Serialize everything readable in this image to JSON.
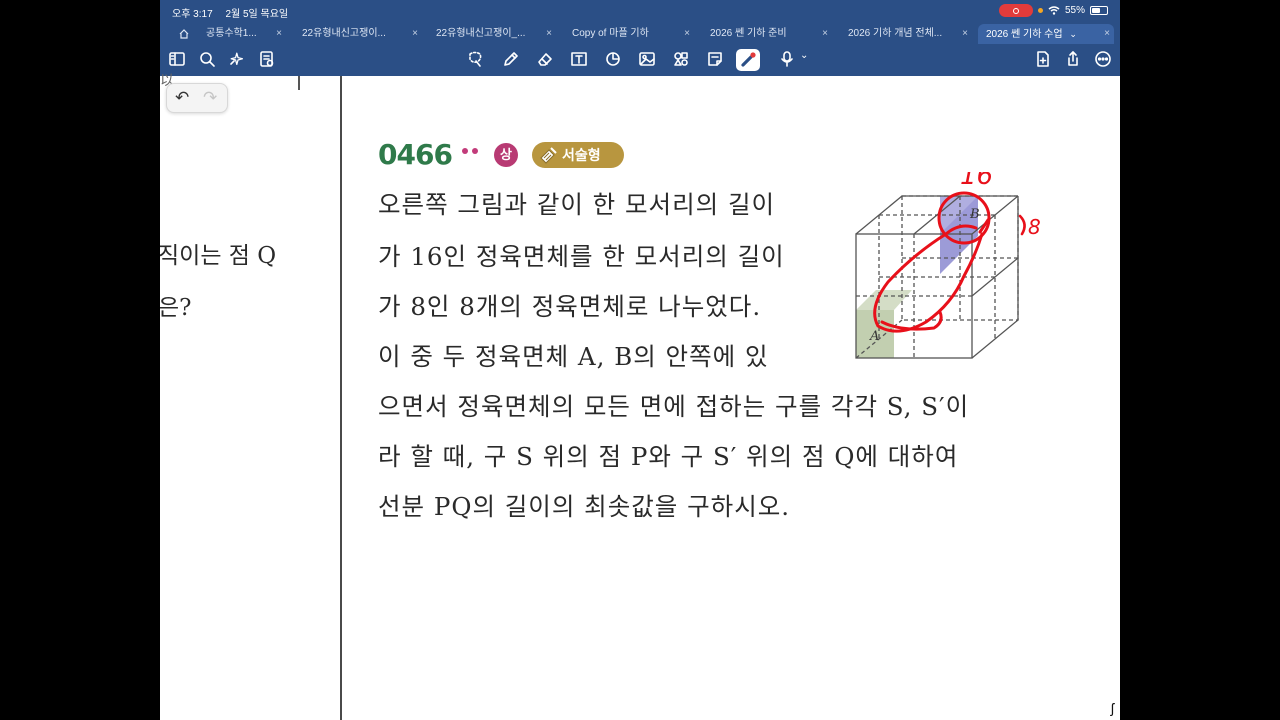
{
  "status_bar": {
    "time": "오후 3:17",
    "date": "2월 5일 목요일",
    "battery": "55%",
    "battery_level": 0.55
  },
  "tabs": [
    {
      "label": "공통수학1..."
    },
    {
      "label": "22유형내신고쟁이..."
    },
    {
      "label": "22유형내신고쟁이_..."
    },
    {
      "label": "Copy of 마플 기하"
    },
    {
      "label": "2026 쎈 기하 준비"
    },
    {
      "label": "2026 기하 개념 전체..."
    },
    {
      "label": "2026 쎈 기하 수업"
    }
  ],
  "toolbar": {
    "left_icons": [
      "sidebar-icon",
      "search-icon",
      "sparkle-icon",
      "document-icon"
    ],
    "center_icons": [
      "lasso-icon",
      "pen-icon",
      "eraser-icon",
      "text-box-icon",
      "shapes-icon",
      "image-icon",
      "stickers-icon",
      "sticky-note-icon",
      "laser-pointer-icon",
      "microphone-icon"
    ],
    "right_icons": [
      "add-page-icon",
      "share-icon",
      "more-icon"
    ]
  },
  "left_page": {
    "line1": "직이는 점 Q",
    "line2": "은?",
    "top_fragment": "以"
  },
  "problem": {
    "number": "0466",
    "difficulty": "상",
    "type": "서술형",
    "lines": [
      "오른쪽 그림과 같이 한 모서리의 길이",
      "가 16인 정육면체를 한 모서리의 길이",
      "가 8인 8개의 정육면체로 나누었다.",
      "이 중 두 정육면체 A, B의 안쪽에 있",
      "으면서 정육면체의 모든 면에 접하는 구를 각각 S, S′이",
      "라 할 때, 구 S 위의 점 P와 구 S′ 위의 점 Q에 대하여",
      "선분 PQ의 길이의 최솟값을 구하시오."
    ]
  },
  "figure": {
    "label_b": "B",
    "label_a": "A",
    "handwriting_16": "16",
    "handwriting_8": "8"
  },
  "colors": {
    "toolbar": "#2b4f86",
    "problem_number": "#2f7a4a",
    "difficulty": "#b83a73",
    "type_badge": "#b8963f",
    "annotation": "#e8101a"
  }
}
